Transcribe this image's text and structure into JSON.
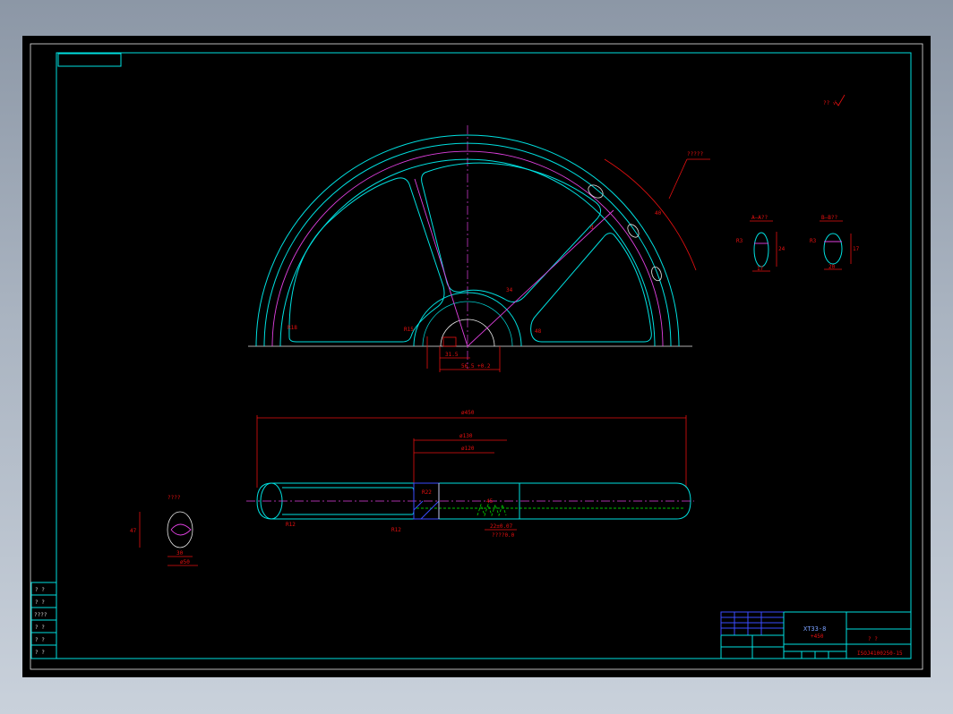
{
  "top_labels": {
    "roughness": "?? √"
  },
  "wheel_dims": {
    "r1": "R18",
    "r2": "R15",
    "r_top": "?????",
    "d1": "31.5",
    "d2": "56.5",
    "d_sub": "+0.2",
    "k1": "d",
    "k2": "40",
    "k3": "34",
    "k4": "48"
  },
  "section_a": {
    "title": "A—A??",
    "w": "17",
    "h": "24",
    "r": "R3"
  },
  "section_b": {
    "title": "B—B??",
    "w": "20",
    "h": "17",
    "r": "R3"
  },
  "rim_dims": {
    "overall": "ø450",
    "mid": "ø130",
    "inner": "ø120",
    "r1": "R22",
    "r2": "R12",
    "r3": "R12",
    "n1": "45",
    "n2": "22±0.07",
    "n3": "????0.0"
  },
  "detail": {
    "title": "????",
    "h": "47",
    "w": "30",
    "d": "ø50"
  },
  "title_block": {
    "part": "XT33-8",
    "sub": "+450",
    "scale": "? ?",
    "dwg": "ISOJ4100250-15"
  },
  "left_strip": [
    "? ?",
    "? ?",
    "????",
    "? ?",
    "? ?",
    "? ?"
  ]
}
